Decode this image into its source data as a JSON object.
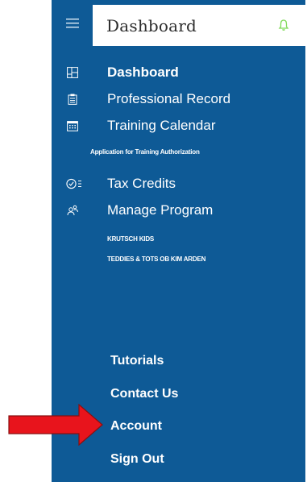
{
  "header": {
    "title": "Dashboard",
    "menu_icon": "hamburger-icon",
    "notify_icon": "bell-icon"
  },
  "nav": {
    "items": [
      {
        "label": "Dashboard",
        "icon": "dashboard-icon"
      },
      {
        "label": "Professional Record",
        "icon": "clipboard-icon"
      },
      {
        "label": "Training Calendar",
        "icon": "calendar-icon"
      },
      {
        "label": "Tax Credits",
        "icon": "checklist-icon"
      },
      {
        "label": "Manage Program",
        "icon": "people-icon"
      }
    ],
    "training_sub": "Application for Training Authorization",
    "program_subs": [
      "KRUTSCH KIDS",
      "TEDDIES & TOTS OB KIM ARDEN"
    ]
  },
  "footer": {
    "items": [
      "Tutorials",
      "Contact Us",
      "Account",
      "Sign Out"
    ]
  },
  "colors": {
    "sidebar": "#0e5a96",
    "accent_green": "#7ed957",
    "arrow": "#e8141c"
  }
}
